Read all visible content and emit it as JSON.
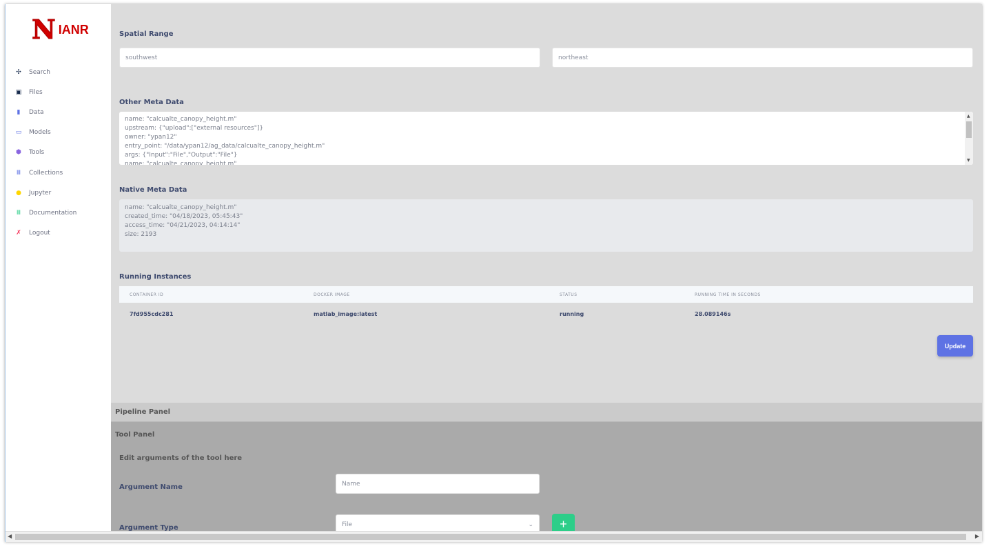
{
  "logo": {
    "mark": "N",
    "text": "IANR"
  },
  "sidebar": {
    "items": [
      {
        "label": "Search",
        "icon": "search-icon",
        "color": "#172b4d",
        "glyph": "✣"
      },
      {
        "label": "Files",
        "icon": "files-icon",
        "color": "#172b4d",
        "glyph": "▣"
      },
      {
        "label": "Data",
        "icon": "chart-bar-icon",
        "color": "#5e72e4",
        "glyph": "▮"
      },
      {
        "label": "Models",
        "icon": "laptop-icon",
        "color": "#5e72e4",
        "glyph": "▭"
      },
      {
        "label": "Tools",
        "icon": "box-icon",
        "color": "#8965e0",
        "glyph": "⬢"
      },
      {
        "label": "Collections",
        "icon": "collection-icon",
        "color": "#5e72e4",
        "glyph": "Ⅲ"
      },
      {
        "label": "Jupyter",
        "icon": "user-icon",
        "color": "#ffd600",
        "glyph": "●"
      },
      {
        "label": "Documentation",
        "icon": "books-icon",
        "color": "#2dce89",
        "glyph": "Ⅲ"
      },
      {
        "label": "Logout",
        "icon": "run-icon",
        "color": "#f5365c",
        "glyph": "✗"
      }
    ]
  },
  "spatial": {
    "title": "Spatial Range",
    "southwest_placeholder": "southwest",
    "northeast_placeholder": "northeast"
  },
  "other_meta": {
    "title": "Other Meta Data",
    "lines": [
      "name: \"calcualte_canopy_height.m\"",
      "upstream: {\"upload\":[\"external resources\"]}",
      "owner: \"ypan12\"",
      "entry_point: \"/data/ypan12/ag_data/calcualte_canopy_height.m\"",
      "args: {\"Input\":\"File\",\"Output\":\"File\"}",
      "name: \"calcualte_canopy_height.m\""
    ]
  },
  "native_meta": {
    "title": "Native Meta Data",
    "lines": [
      "name: \"calcualte_canopy_height.m\"",
      "created_time: \"04/18/2023, 05:45:43\"",
      "access_time: \"04/21/2023, 04:14:14\"",
      "size: 2193"
    ]
  },
  "instances": {
    "title": "Running Instances",
    "columns": [
      "CONTAINER ID",
      "DOCKER IMAGE",
      "STATUS",
      "RUNNING TIME IN SECONDS"
    ],
    "rows": [
      [
        "7fd955cdc281",
        "matlab_image:latest",
        "running",
        "28.089146s"
      ]
    ]
  },
  "update_label": "Update",
  "pipeline": {
    "title": "Pipeline Panel"
  },
  "tool": {
    "title": "Tool Panel",
    "subtitle": "Edit arguments of the tool here",
    "arg_name_label": "Argument Name",
    "arg_name_placeholder": "Name",
    "arg_type_label": "Argument Type",
    "arg_type_value": "File",
    "add_label": "+"
  }
}
